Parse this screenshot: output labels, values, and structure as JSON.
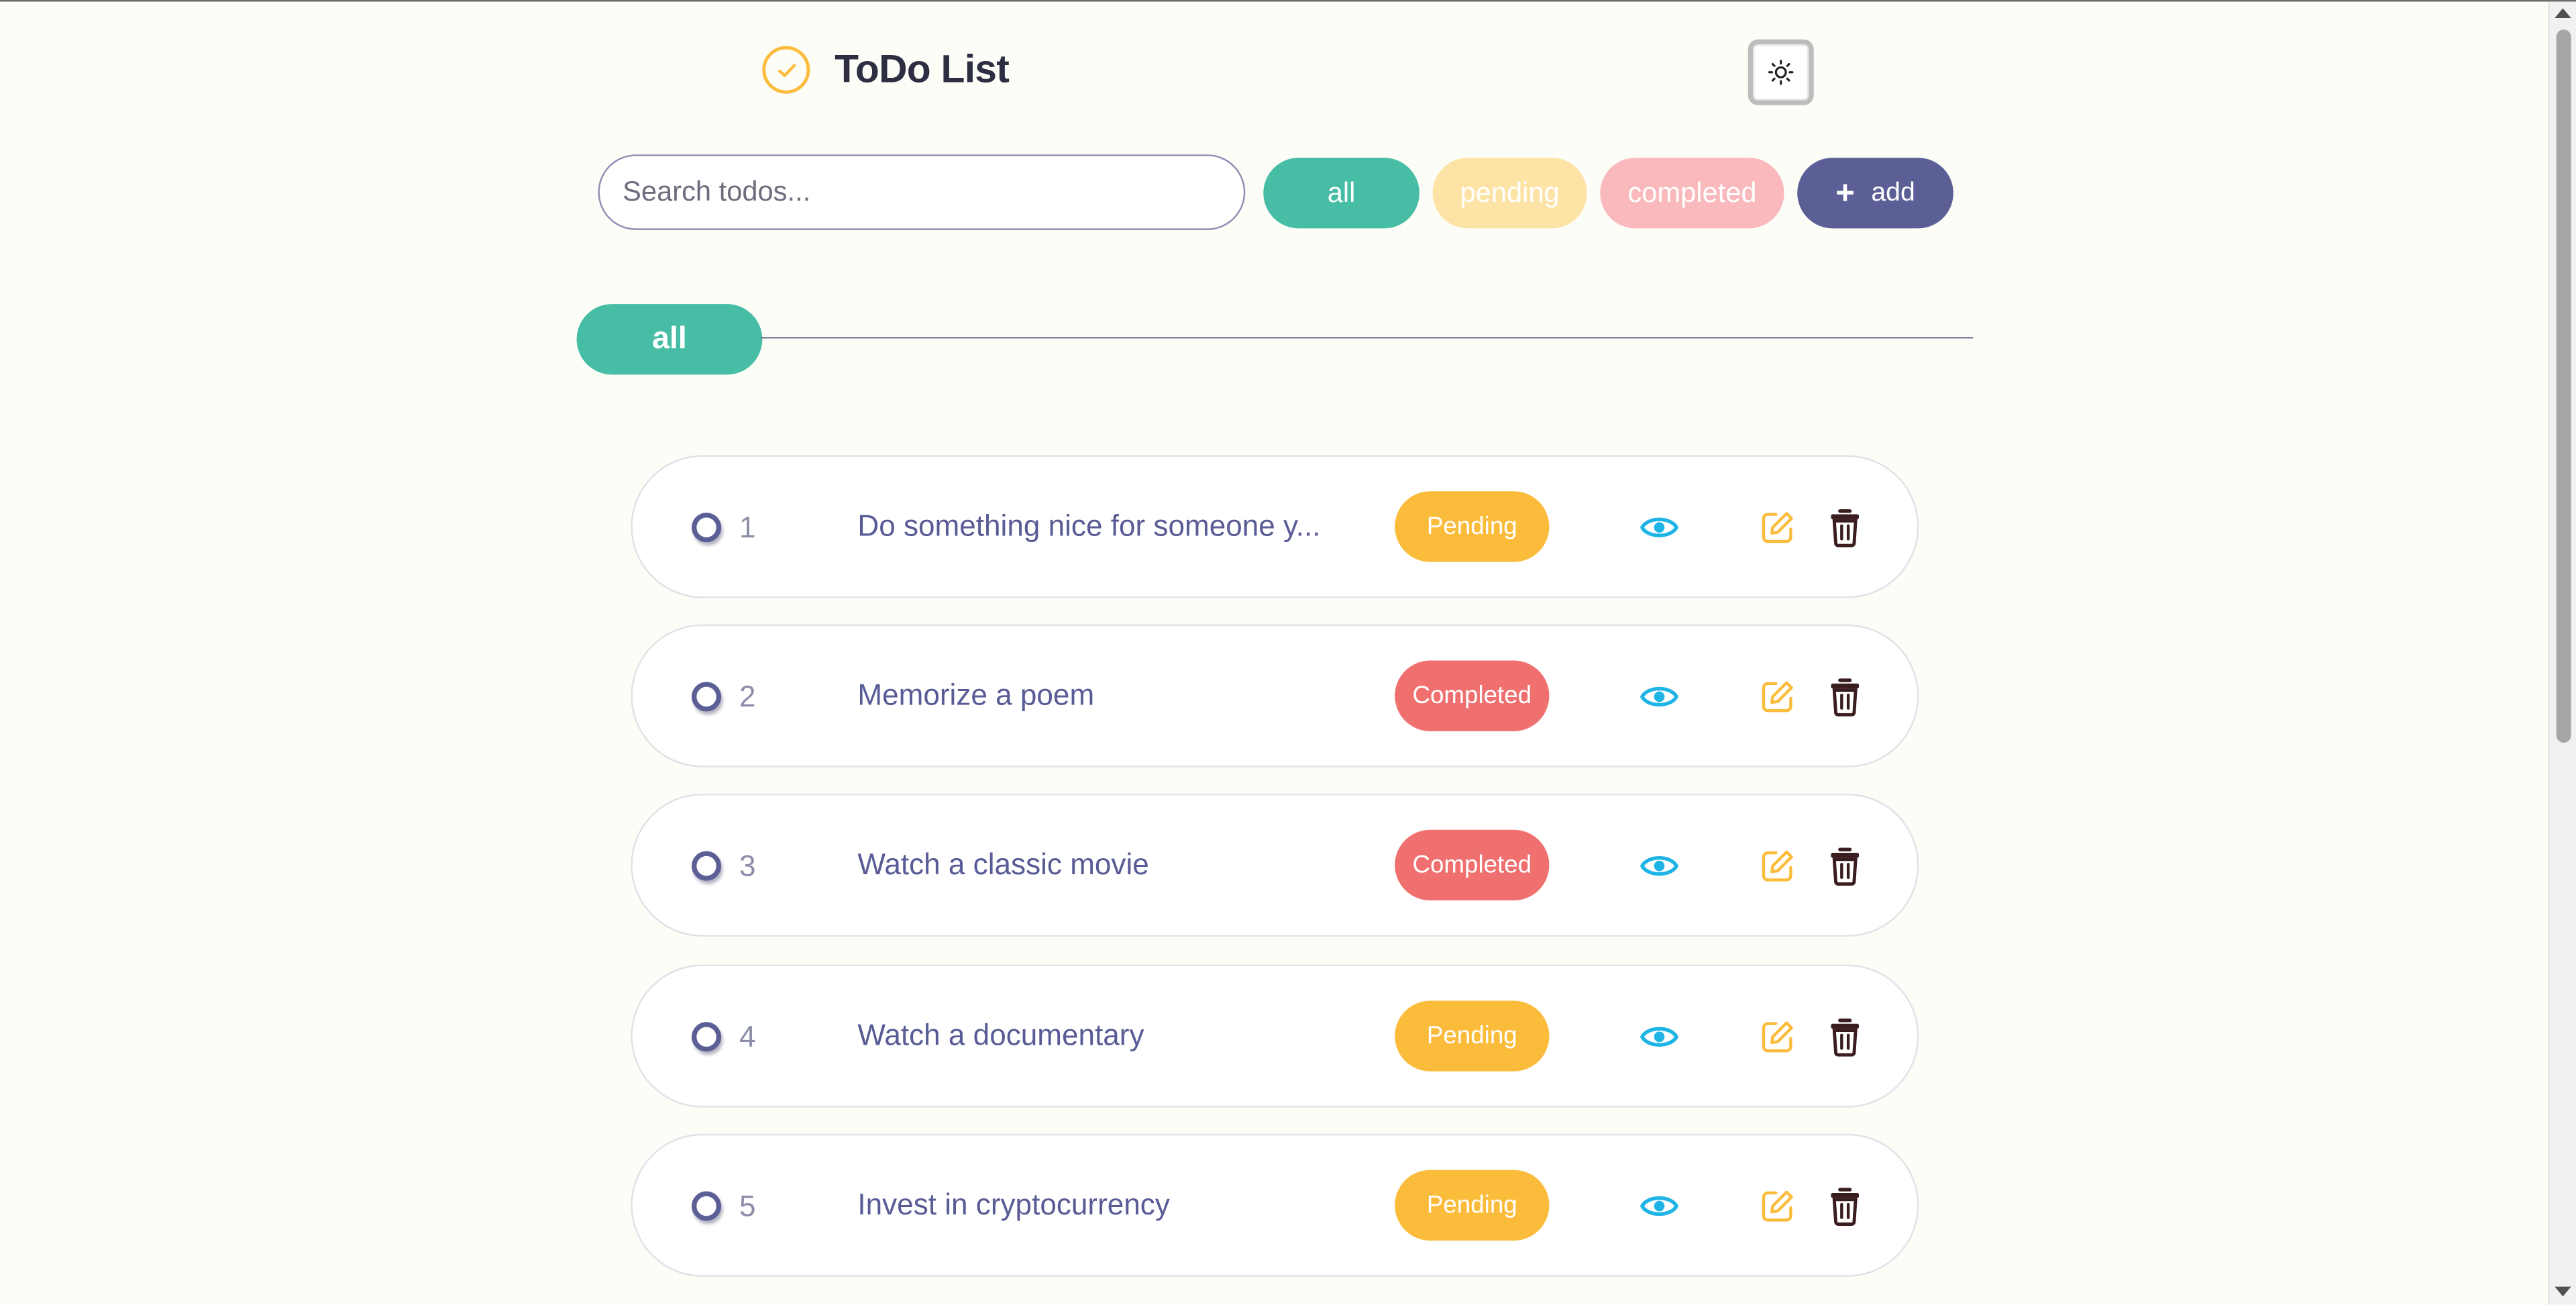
{
  "header": {
    "title": "ToDo List",
    "logo_icon": "check-circle-icon",
    "theme_toggle_icon": "sun-icon"
  },
  "toolbar": {
    "search_placeholder": "Search todos...",
    "search_value": "",
    "filters": {
      "all": "all",
      "pending": "pending",
      "completed": "completed"
    },
    "add_label": "add",
    "add_icon": "plus-icon"
  },
  "section": {
    "label": "all"
  },
  "todos": [
    {
      "id": "1",
      "title": "Do something nice for someone y...",
      "status": "Pending"
    },
    {
      "id": "2",
      "title": "Memorize a poem",
      "status": "Completed"
    },
    {
      "id": "3",
      "title": "Watch a classic movie",
      "status": "Completed"
    },
    {
      "id": "4",
      "title": "Watch a documentary",
      "status": "Pending"
    },
    {
      "id": "5",
      "title": "Invest in cryptocurrency",
      "status": "Pending"
    }
  ],
  "row_action_icons": [
    "eye-icon",
    "edit-icon",
    "trash-icon"
  ],
  "colors": {
    "background": "#fdfdf8",
    "accent_teal": "#46bda4",
    "pending": "#fbbc3c",
    "completed": "#f07070",
    "primary": "#5c5f96",
    "view_icon": "#1eb4e6",
    "edit_icon": "#fbbc3c",
    "delete_icon": "#3a1d1f"
  }
}
